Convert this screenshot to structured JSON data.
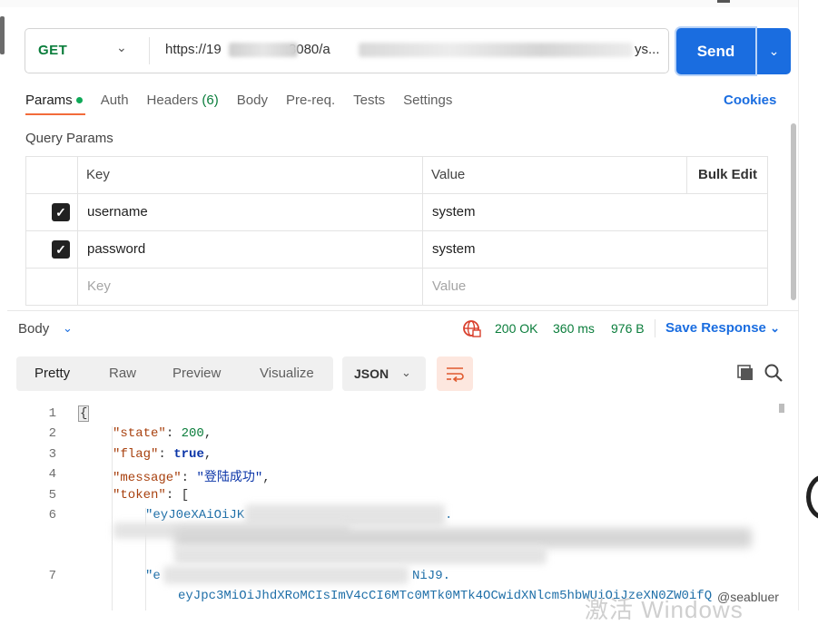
{
  "request": {
    "method": "GET",
    "url_prefix": "https://19",
    "url_port": ":8080/a",
    "url_suffix": "ys...",
    "send_label": "Send"
  },
  "tabs": [
    {
      "label": "Params"
    },
    {
      "label": "Auth"
    },
    {
      "label": "Headers",
      "count": "(6)"
    },
    {
      "label": "Body"
    },
    {
      "label": "Pre-req."
    },
    {
      "label": "Tests"
    },
    {
      "label": "Settings"
    }
  ],
  "cookies_label": "Cookies",
  "query_params_title": "Query Params",
  "params_table": {
    "headers": {
      "key": "Key",
      "value": "Value",
      "bulk": "Bulk Edit"
    },
    "rows": [
      {
        "key": "username",
        "value": "system",
        "checked": true
      },
      {
        "key": "password",
        "value": "system",
        "checked": true
      }
    ],
    "placeholder": {
      "key": "Key",
      "value": "Value"
    }
  },
  "response": {
    "body_label": "Body",
    "status": "200 OK",
    "time": "360 ms",
    "size": "976 B",
    "save_label": "Save Response",
    "view_tabs": [
      "Pretty",
      "Raw",
      "Preview",
      "Visualize"
    ],
    "format": "JSON"
  },
  "code": {
    "line_numbers": [
      "1",
      "2",
      "3",
      "4",
      "5",
      "6",
      "7"
    ],
    "lines": {
      "l1": "{",
      "l2_key": "\"state\"",
      "l2_val": "200",
      "l3_key": "\"flag\"",
      "l3_val": "true",
      "l4_key": "\"message\"",
      "l4_val": "\"登陆成功\"",
      "l5_key": "\"token\"",
      "l5_val": "[",
      "l6": "\"eyJ0eXAiOiJK",
      "l6_tail": ".",
      "l7": "\"e",
      "l7_tail": "NiJ9.",
      "l7_cont": "eyJpc3MiOiJhdXRoMCIsImV4cCI6MTc0MTk0MTk4OCwidXNlcm5hbWUiOiJzeXN0ZW0ifQ"
    }
  },
  "watermark": "激活 Windows",
  "credit": "@seabluer",
  "colors": {
    "accent": "#1a6de0",
    "green": "#0a7d3b",
    "json_key": "#a8410f",
    "active_tab": "#f26b3a"
  }
}
